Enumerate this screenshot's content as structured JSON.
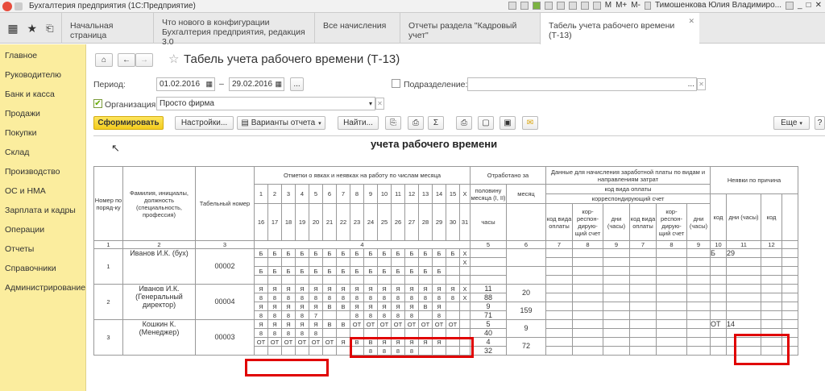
{
  "titlebar": {
    "app": "Бухгалтерия предприятия  (1С:Предприятие)",
    "user": "Тимошенкова Юлия Владимиро...",
    "icons": [
      "M",
      "M+",
      "M-"
    ]
  },
  "tabs": [
    {
      "label": "Начальная страница"
    },
    {
      "label": "Что нового в конфигурации Бухгалтерия предприятия, редакция 3.0"
    },
    {
      "label": "Все начисления"
    },
    {
      "label": "Отчеты раздела \"Кадровый учет\""
    },
    {
      "label": "Табель учета рабочего времени (Т-13)"
    }
  ],
  "sidebar": [
    "Главное",
    "Руководителю",
    "Банк и касса",
    "Продажи",
    "Покупки",
    "Склад",
    "Производство",
    "ОС и НМА",
    "Зарплата и кадры",
    "Операции",
    "Отчеты",
    "Справочники",
    "Администрирование"
  ],
  "form": {
    "title": "Табель учета рабочего времени (Т-13)",
    "period_label": "Период:",
    "date_from": "01.02.2016",
    "date_to": "29.02.2016",
    "dash": "–",
    "dots": "...",
    "subdivision_label": "Подразделение:",
    "org_label": "Организация:",
    "org_value": "Просто фирма",
    "btn_generate": "Сформировать",
    "btn_settings": "Настройки...",
    "btn_variants": "Варианты отчета",
    "btn_find": "Найти...",
    "btn_more": "Еще",
    "btn_help": "?"
  },
  "report": {
    "heading": "учета  рабочего времени",
    "headers": {
      "num": "Номер по поряд-ку",
      "fio": "Фамилия, инициалы, должность (специальность, профессия)",
      "tab": "Табельный номер",
      "marks": "Отметки о явках и неявках на работу по числам месяца",
      "worked": "Отработано за",
      "half": "половину месяца (I, II)",
      "month": "месяц",
      "days": "дни",
      "hours": "часы",
      "payroll": "Данные для начисления заработной платы по видам и направлениям затрат",
      "paytype": "код вида оплаты",
      "corr": "корреспондирующий счет",
      "code_pay": "код вида оплаты",
      "corr_acc": "кор-респон-дирую-щий счет",
      "days_h": "дни (часы)",
      "absence": "Неявки по причина",
      "code": "код",
      "days_hours": "дни (часы)",
      "x": "X"
    },
    "days1": [
      "1",
      "2",
      "3",
      "4",
      "5",
      "6",
      "7",
      "8",
      "9",
      "10",
      "11",
      "12",
      "13",
      "14",
      "15",
      "X"
    ],
    "days2": [
      "16",
      "17",
      "18",
      "19",
      "20",
      "21",
      "22",
      "23",
      "24",
      "25",
      "26",
      "27",
      "28",
      "29",
      "30",
      "31"
    ],
    "colnums": [
      "1",
      "2",
      "3",
      "4",
      "5",
      "6",
      "7",
      "8",
      "9",
      "7",
      "8",
      "9",
      "10",
      "11",
      "12"
    ],
    "employees": [
      {
        "num": "1",
        "name": "Иванов И.К. (бух)",
        "tab": "00002",
        "r1": [
          "Б",
          "Б",
          "Б",
          "Б",
          "Б",
          "Б",
          "Б",
          "Б",
          "Б",
          "Б",
          "Б",
          "Б",
          "Б",
          "Б",
          "Б",
          "X"
        ],
        "r2": [
          "",
          "",
          "",
          "",
          "",
          "",
          "",
          "",
          "",
          "",
          "",
          "",
          "",
          "",
          "",
          "X"
        ],
        "r3": [
          "Б",
          "Б",
          "Б",
          "Б",
          "Б",
          "Б",
          "Б",
          "Б",
          "Б",
          "Б",
          "Б",
          "Б",
          "Б",
          "Б",
          "",
          ""
        ],
        "r4": [
          "",
          "",
          "",
          "",
          "",
          "",
          "",
          "",
          "",
          "",
          "",
          "",
          "",
          "",
          "",
          ""
        ],
        "h1": "",
        "h2": "",
        "m1": "",
        "m2": "",
        "abs_code": "Б",
        "abs_days": "29"
      },
      {
        "num": "2",
        "name": "Иванов И.К. (Генеральный директор)",
        "tab": "00004",
        "r1": [
          "Я",
          "Я",
          "Я",
          "Я",
          "Я",
          "Я",
          "Я",
          "Я",
          "Я",
          "Я",
          "Я",
          "Я",
          "Я",
          "Я",
          "Я",
          "X"
        ],
        "r2": [
          "8",
          "8",
          "8",
          "8",
          "8",
          "8",
          "8",
          "8",
          "8",
          "8",
          "8",
          "8",
          "8",
          "8",
          "8",
          "X"
        ],
        "r3": [
          "Я",
          "Я",
          "Я",
          "Я",
          "Я",
          "В",
          "В",
          "Я",
          "Я",
          "Я",
          "Я",
          "Я",
          "В",
          "Я",
          "",
          ""
        ],
        "r4": [
          "8",
          "8",
          "8",
          "8",
          "7",
          "",
          "",
          "8",
          "8",
          "8",
          "8",
          "8",
          "",
          "8",
          "",
          ""
        ],
        "h1": "11",
        "h2": "88",
        "h3": "9",
        "h4": "71",
        "m1": "20",
        "m2": "159"
      },
      {
        "num": "3",
        "name": "Кошкин К. (Менеджер)",
        "tab": "00003",
        "r1": [
          "Я",
          "Я",
          "Я",
          "Я",
          "Я",
          "В",
          "В",
          "ОТ",
          "ОТ",
          "ОТ",
          "ОТ",
          "ОТ",
          "ОТ",
          "ОТ",
          "ОТ",
          ""
        ],
        "r2": [
          "8",
          "8",
          "8",
          "8",
          "8",
          "",
          "",
          "",
          "",
          "",
          "",
          "",
          "",
          "",
          "",
          ""
        ],
        "r3": [
          "ОТ",
          "ОТ",
          "ОТ",
          "ОТ",
          "ОТ",
          "ОТ",
          "Я",
          "В",
          "В",
          "Я",
          "Я",
          "Я",
          "Я",
          "Я",
          "",
          ""
        ],
        "r4": [
          "",
          "",
          "",
          "",
          "",
          "",
          "",
          "",
          "8",
          "8",
          "8",
          "8",
          "",
          "",
          "",
          ""
        ],
        "h1": "5",
        "h2": "40",
        "h3": "4",
        "h4": "32",
        "m1": "9",
        "m2": "72",
        "abs_code": "ОТ",
        "abs_days": "14"
      }
    ]
  }
}
